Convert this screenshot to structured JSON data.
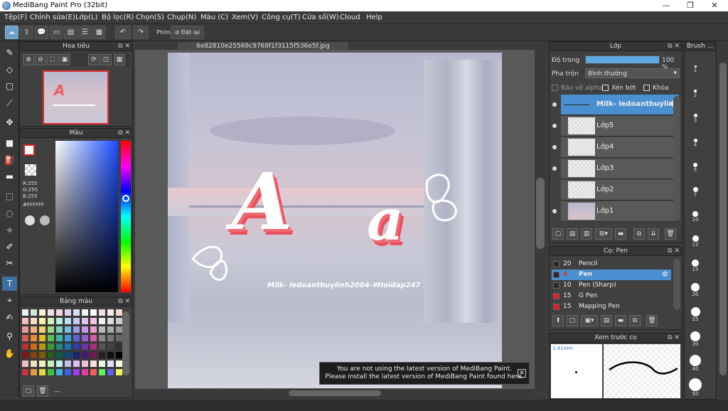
{
  "title": "MediBang Paint Pro (32bit)",
  "menu": [
    "Tệp(F)",
    "Chỉnh sửa(E)",
    "Lớp(L)",
    "Bộ lọc(R)",
    "Chọn(S)",
    "Chụp(N)",
    "Màu (C)",
    "Xem(V)",
    "Công cụ(T)",
    "Cửa số(W)",
    "Cloud",
    "Help"
  ],
  "toolbar": {
    "shortcut_label": "Phím",
    "reset_label": "Đặt lại"
  },
  "navigator": {
    "title": "Hoa tiêu"
  },
  "color": {
    "title": "Màu",
    "r": "R:255",
    "g": "G:255",
    "b": "B:255",
    "hex": "#FFFFFF"
  },
  "palette_panel": {
    "title": "Bảng màu",
    "footer": "---",
    "colors": [
      "#e9f2f2",
      "#cbe8d8",
      "#f6f2cf",
      "#f2dfe0",
      "#f7d8e0",
      "#e1d2ef",
      "#d8dff7",
      "#f2f2f2",
      "#ffffff",
      "#ece0e8",
      "#f7e7f0",
      "#f1d6cd",
      "#f3c1c2",
      "#f9dcc1",
      "#f7f0b1",
      "#d4f0bb",
      "#b9ede1",
      "#b8dff1",
      "#c9c9ef",
      "#e2c5ef",
      "#f5c6e3",
      "#eeeeee",
      "#dddddd",
      "#cccccc",
      "#e79c9c",
      "#f0b27c",
      "#ecd26c",
      "#9ed98a",
      "#7fd3c6",
      "#79bfe4",
      "#9a9ee3",
      "#c49be0",
      "#ea9cc8",
      "#bbbbbb",
      "#aaaaaa",
      "#999999",
      "#d85a5a",
      "#ea8c3a",
      "#dfc030",
      "#5fbf57",
      "#3fb6a6",
      "#3f98d6",
      "#5c63d0",
      "#9a5ed0",
      "#d65da8",
      "#888888",
      "#777777",
      "#666666",
      "#b83232",
      "#c86a1a",
      "#b8981a",
      "#3c9a34",
      "#208a7a",
      "#2070b0",
      "#343ca8",
      "#7030a8",
      "#a83080",
      "#555555",
      "#444444",
      "#333333",
      "#7a1a1a",
      "#844010",
      "#786010",
      "#20601a",
      "#105a50",
      "#104a78",
      "#1c2070",
      "#481c70",
      "#701c54",
      "#222222",
      "#111111",
      "#000000",
      "#f0c0c0",
      "#f0e0c0",
      "#f0f0c0",
      "#c0f0c0",
      "#c0f0f0",
      "#c0c0f0",
      "#e0c0f0",
      "#f0c0e0",
      "#ffe0e0",
      "#e0ffe0",
      "#e0e0ff",
      "#ffffe0",
      "#c8324a",
      "#e0a040",
      "#e8d840",
      "#40c040",
      "#40b0e0",
      "#4060e0",
      "#a040e0",
      "#e040a0",
      "#f06060",
      "#60f060",
      "#6060f0",
      "#f0f060"
    ]
  },
  "canvas": {
    "filename": "6e82810e25569c9769f1f3115f536e5f.jpg",
    "letter_big": "A",
    "letter_small": "a",
    "watermark": "Milk- ledoanthuylinh2004-#Hoidap247"
  },
  "notification": {
    "line1": "You are not using the latest version of MediBang Paint.",
    "line2": "Please install the latest version of MediBang Paint found here."
  },
  "layers": {
    "title": "Lớp",
    "opacity_label": "Độ trong",
    "opacity_value": "100 %",
    "opacity_fraction": 1.0,
    "blend_label": "Pha trộn",
    "blend_value": "Bình thường",
    "protect_alpha": "Bảo vệ alpha",
    "clipping": "Xén bớt",
    "lock": "Khóa",
    "items": [
      {
        "name": "Milk- ledoanthuylinh",
        "selected": true
      },
      {
        "name": "Lớp5"
      },
      {
        "name": "Lớp4"
      },
      {
        "name": "Lớp3"
      },
      {
        "name": "Lớp2"
      },
      {
        "name": "Lớp1"
      }
    ]
  },
  "brush": {
    "title": "Cọ: Pen",
    "items": [
      {
        "size": "20",
        "name": "Pencil",
        "color": "#2a2a2a"
      },
      {
        "size": "4",
        "name": "Pen",
        "color": "#2a2a2a",
        "selected": true
      },
      {
        "size": "10",
        "name": "Pen (Sharp)",
        "color": "#2a2a2a"
      },
      {
        "size": "15",
        "name": "G Pen",
        "color": "#e02020"
      },
      {
        "size": "15",
        "name": "Mapping Pen",
        "color": "#e02020"
      }
    ]
  },
  "preview": {
    "title": "Xem trước cọ",
    "size": "1.41mm"
  },
  "brush_size": {
    "title": "Brush ...",
    "sizes": [
      "1",
      "2",
      "3",
      "4",
      "5",
      "7",
      "10",
      "12",
      "15",
      "20",
      "25",
      "30",
      "40",
      "50"
    ]
  }
}
